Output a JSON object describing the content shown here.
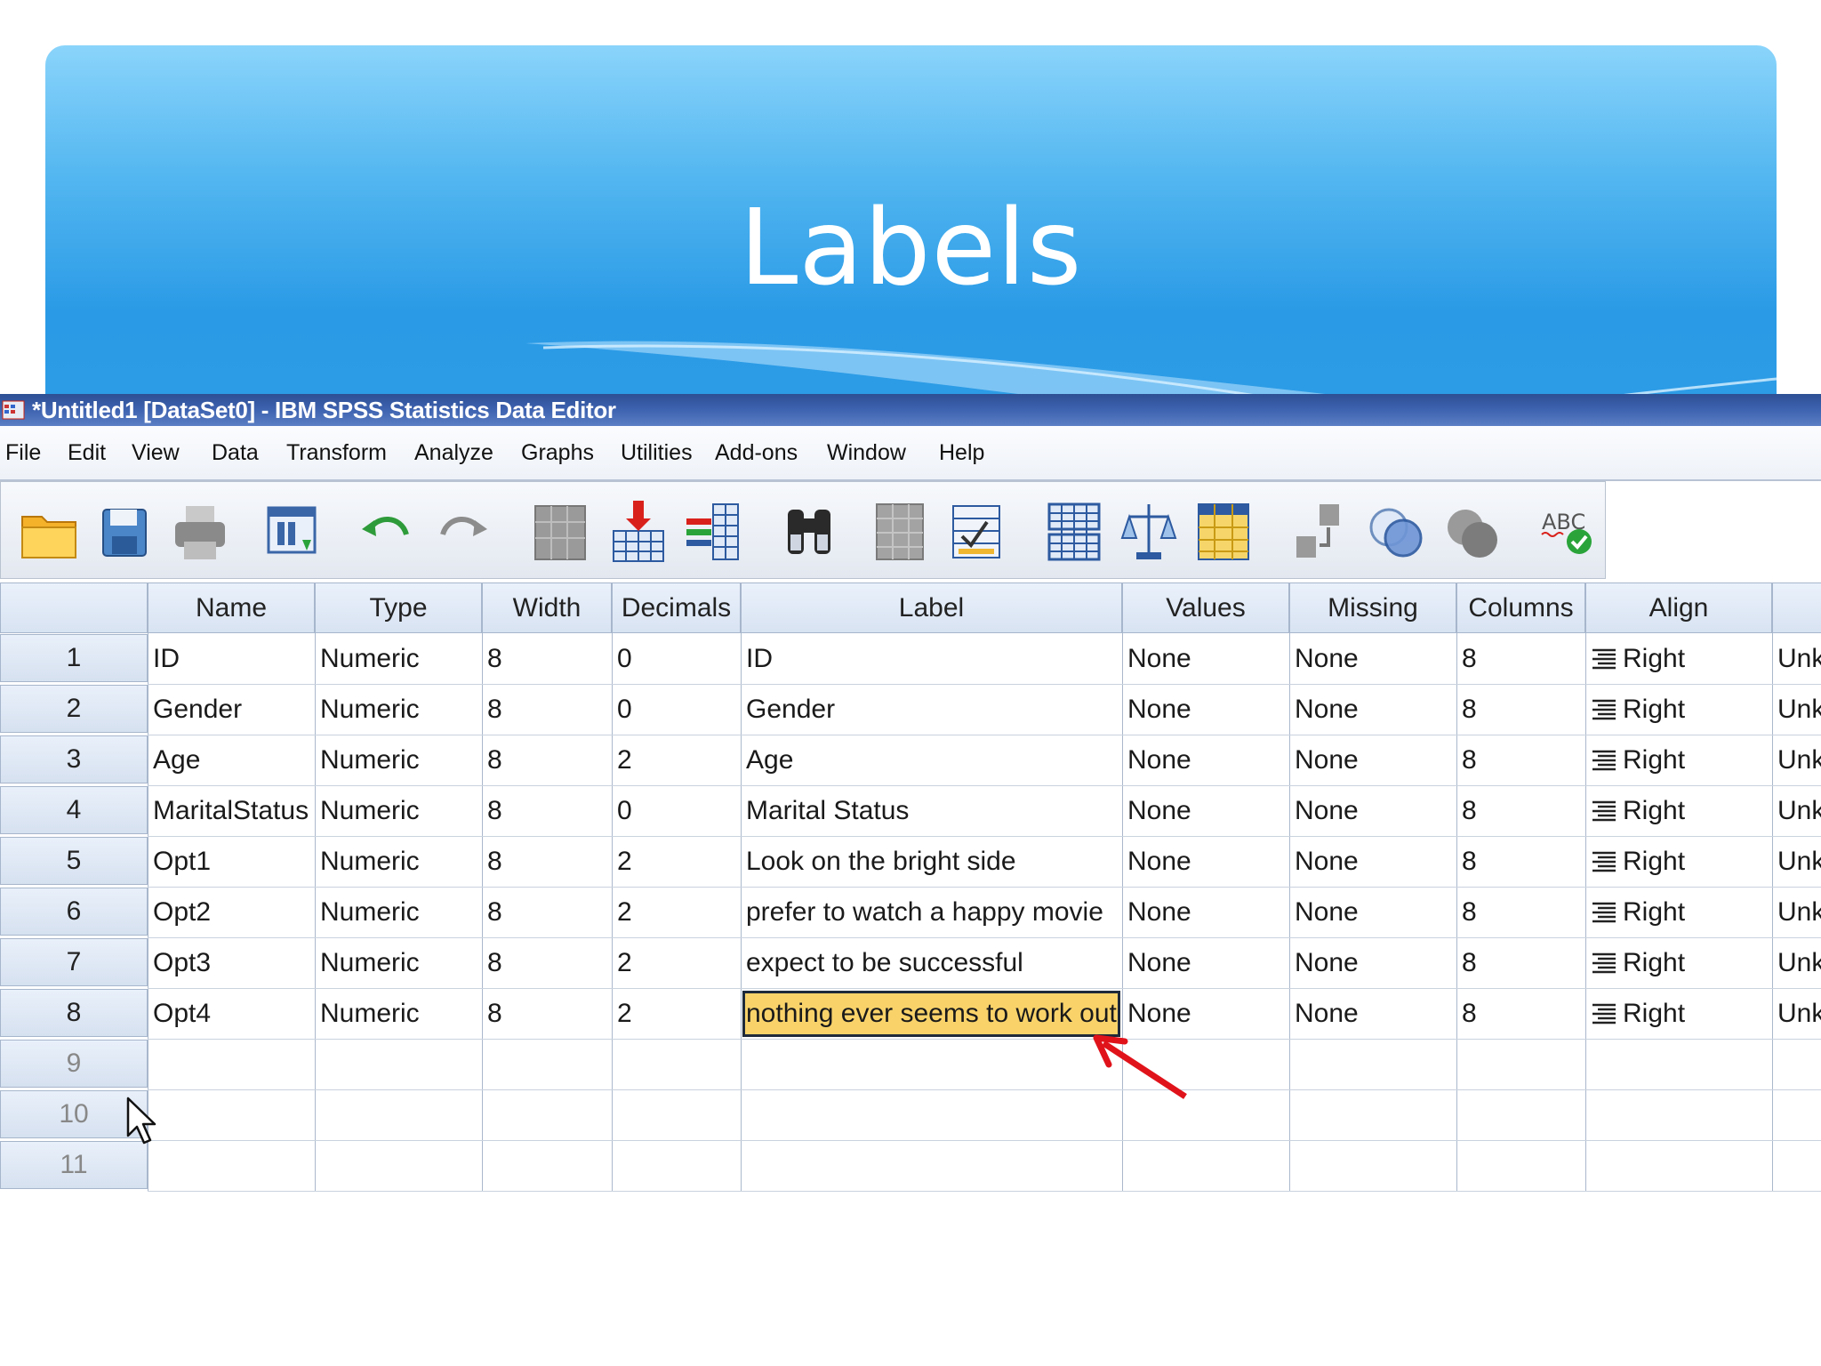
{
  "slide": {
    "title": "Labels"
  },
  "window": {
    "title": "*Untitled1 [DataSet0] - IBM SPSS Statistics Data Editor"
  },
  "menu": [
    "File",
    "Edit",
    "View",
    "Data",
    "Transform",
    "Analyze",
    "Graphs",
    "Utilities",
    "Add-ons",
    "Window",
    "Help"
  ],
  "toolbar": [
    "open-folder-icon",
    "save-icon",
    "print-icon",
    "recall-dialog-icon",
    "undo-icon",
    "redo-icon",
    "goto-case-icon",
    "goto-variable-icon",
    "variables-icon",
    "find-icon",
    "insert-cases-icon",
    "insert-variable-icon",
    "split-file-icon",
    "weight-cases-icon",
    "select-cases-icon",
    "value-labels-icon",
    "use-sets-icon",
    "show-all-variables-icon",
    "spell-check-icon"
  ],
  "columns": [
    "Name",
    "Type",
    "Width",
    "Decimals",
    "Label",
    "Values",
    "Missing",
    "Columns",
    "Align",
    ""
  ],
  "rows": [
    {
      "num": "1",
      "name": "ID",
      "type": "Numeric",
      "width": "8",
      "decimals": "0",
      "label": "ID",
      "values": "None",
      "missing": "None",
      "columns": "8",
      "align": "Right",
      "measure": "Unk"
    },
    {
      "num": "2",
      "name": "Gender",
      "type": "Numeric",
      "width": "8",
      "decimals": "0",
      "label": "Gender",
      "values": "None",
      "missing": "None",
      "columns": "8",
      "align": "Right",
      "measure": "Unk"
    },
    {
      "num": "3",
      "name": "Age",
      "type": "Numeric",
      "width": "8",
      "decimals": "2",
      "label": "Age",
      "values": "None",
      "missing": "None",
      "columns": "8",
      "align": "Right",
      "measure": "Unk"
    },
    {
      "num": "4",
      "name": "MaritalStatus",
      "type": "Numeric",
      "width": "8",
      "decimals": "0",
      "label": "Marital Status",
      "values": "None",
      "missing": "None",
      "columns": "8",
      "align": "Right",
      "measure": "Unk"
    },
    {
      "num": "5",
      "name": "Opt1",
      "type": "Numeric",
      "width": "8",
      "decimals": "2",
      "label": "Look on the bright side",
      "values": "None",
      "missing": "None",
      "columns": "8",
      "align": "Right",
      "measure": "Unk"
    },
    {
      "num": "6",
      "name": "Opt2",
      "type": "Numeric",
      "width": "8",
      "decimals": "2",
      "label": "prefer to watch a happy movie",
      "values": "None",
      "missing": "None",
      "columns": "8",
      "align": "Right",
      "measure": "Unk"
    },
    {
      "num": "7",
      "name": "Opt3",
      "type": "Numeric",
      "width": "8",
      "decimals": "2",
      "label": "expect to be successful",
      "values": "None",
      "missing": "None",
      "columns": "8",
      "align": "Right",
      "measure": "Unk"
    },
    {
      "num": "8",
      "name": "Opt4",
      "type": "Numeric",
      "width": "8",
      "decimals": "2",
      "label": "nothing ever seems to work out",
      "values": "None",
      "missing": "None",
      "columns": "8",
      "align": "Right",
      "measure": "Unk"
    }
  ],
  "empty_rows": [
    "9",
    "10",
    "11"
  ],
  "selected": {
    "row": "8",
    "column": "Label"
  },
  "colors": {
    "header_blue": "#2e9de6",
    "titlebar": "#3e63b0",
    "selected_cell": "#f9d36a",
    "arrow": "#e0131b"
  }
}
